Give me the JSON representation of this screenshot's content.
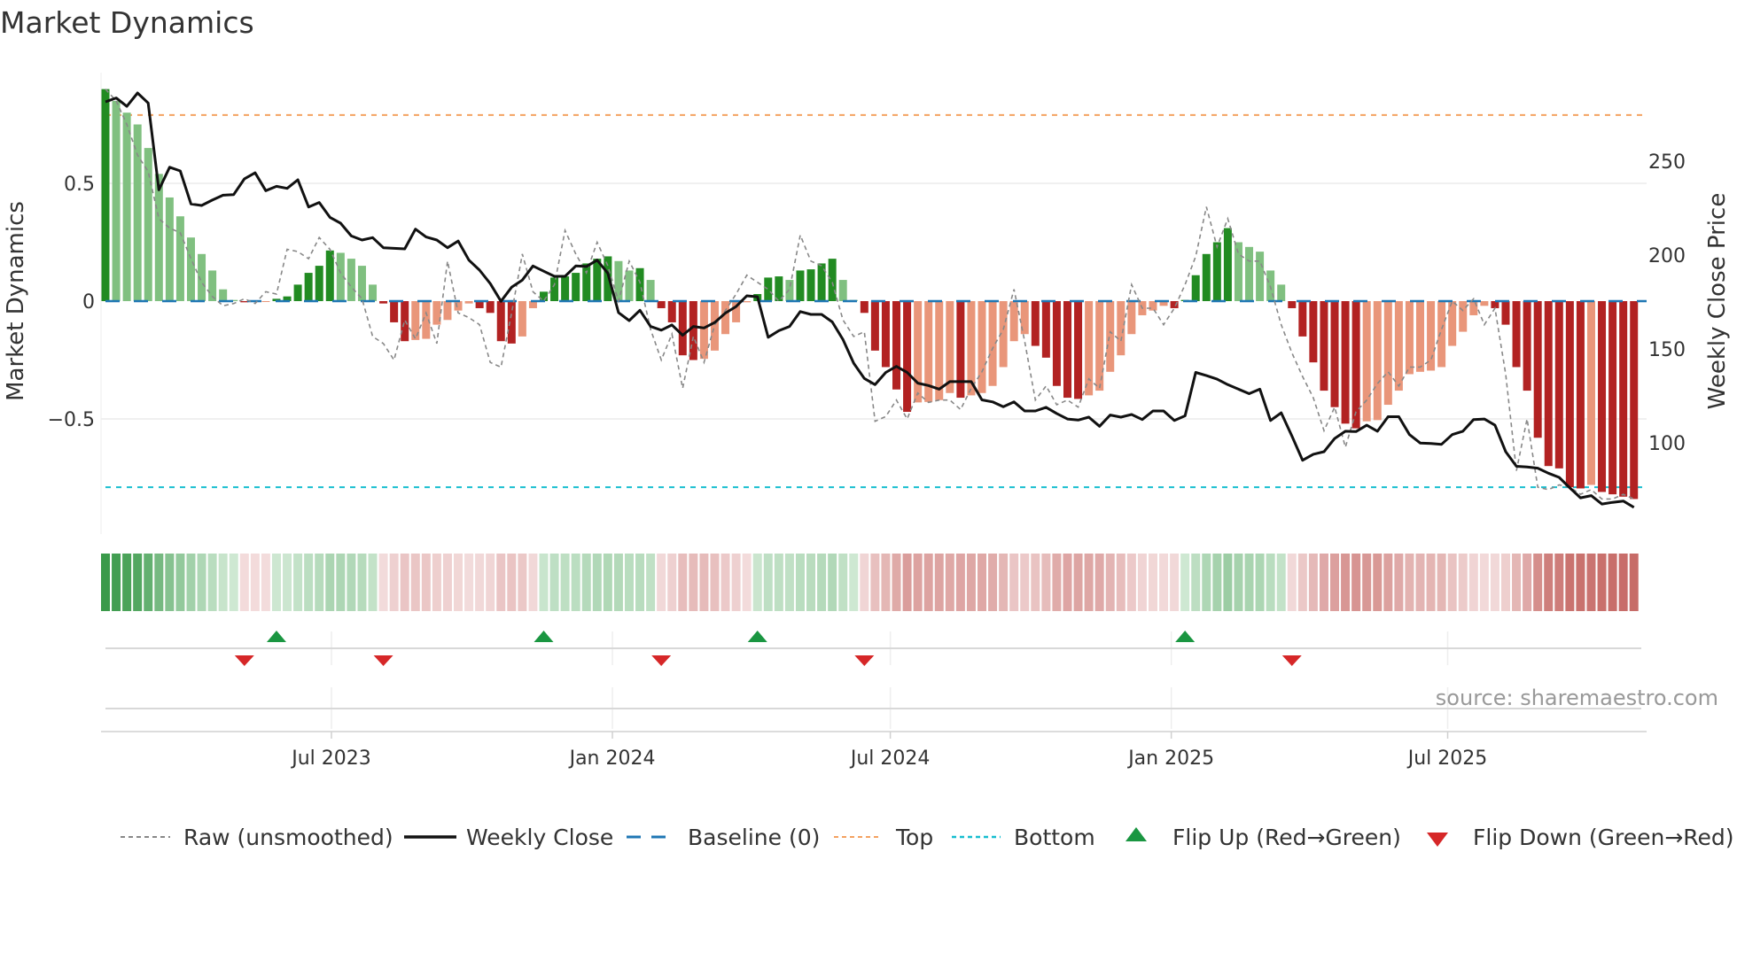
{
  "chart_data": {
    "type": "bar",
    "title": "Market Dynamics",
    "ylabel": "Market Dynamics",
    "y2label": "Weekly Close Price",
    "ylim": [
      -0.98,
      0.98
    ],
    "y2lim": [
      63,
      290
    ],
    "yticks": [
      {
        "value": 0.5,
        "label": "0.5"
      },
      {
        "value": 0,
        "label": "0"
      },
      {
        "value": -0.5,
        "label": "−0.5"
      }
    ],
    "y2ticks": [
      {
        "value": 250,
        "label": "250"
      },
      {
        "value": 200,
        "label": "200"
      },
      {
        "value": 150,
        "label": "150"
      },
      {
        "value": 100,
        "label": "100"
      }
    ],
    "xticks": [
      {
        "date": "2023-07-01",
        "label": "Jul 2023"
      },
      {
        "date": "2024-01-01",
        "label": "Jan 2024"
      },
      {
        "date": "2024-07-01",
        "label": "Jul 2024"
      },
      {
        "date": "2025-01-01",
        "label": "Jan 2025"
      },
      {
        "date": "2025-07-01",
        "label": "Jul 2025"
      }
    ],
    "start_date": "2023-02-03",
    "frequency": "weekly",
    "top_level": 0.79,
    "bottom_level": -0.79,
    "baseline": 0,
    "series": [
      {
        "name": "Market Dynamics (smoothed)",
        "values": [
          0.9,
          0.85,
          0.8,
          0.75,
          0.65,
          0.54,
          0.44,
          0.36,
          0.27,
          0.2,
          0.13,
          0.05,
          0.005,
          -0.005,
          -0.004,
          -0.002,
          0.01,
          0.02,
          0.07,
          0.12,
          0.15,
          0.215,
          0.205,
          0.18,
          0.15,
          0.07,
          -0.01,
          -0.09,
          -0.17,
          -0.165,
          -0.16,
          -0.1,
          -0.08,
          -0.04,
          -0.01,
          -0.03,
          -0.05,
          -0.17,
          -0.18,
          -0.15,
          -0.03,
          0.04,
          0.1,
          0.105,
          0.12,
          0.16,
          0.18,
          0.19,
          0.17,
          0.13,
          0.14,
          0.09,
          -0.03,
          -0.09,
          -0.23,
          -0.25,
          -0.245,
          -0.21,
          -0.14,
          -0.09,
          -0.005,
          0.03,
          0.1,
          0.105,
          0.09,
          0.13,
          0.135,
          0.16,
          0.18,
          0.09,
          0.005,
          -0.05,
          -0.21,
          -0.28,
          -0.375,
          -0.47,
          -0.43,
          -0.428,
          -0.42,
          -0.39,
          -0.41,
          -0.4,
          -0.39,
          -0.36,
          -0.28,
          -0.17,
          -0.14,
          -0.19,
          -0.24,
          -0.36,
          -0.41,
          -0.415,
          -0.4,
          -0.38,
          -0.3,
          -0.23,
          -0.14,
          -0.06,
          -0.04,
          -0.02,
          -0.03,
          0.005,
          0.11,
          0.2,
          0.25,
          0.31,
          0.25,
          0.23,
          0.21,
          0.13,
          0.07,
          -0.03,
          -0.15,
          -0.26,
          -0.38,
          -0.45,
          -0.52,
          -0.54,
          -0.51,
          -0.505,
          -0.44,
          -0.38,
          -0.31,
          -0.3,
          -0.295,
          -0.28,
          -0.19,
          -0.13,
          -0.06,
          -0.02,
          -0.03,
          -0.1,
          -0.28,
          -0.38,
          -0.58,
          -0.7,
          -0.71,
          -0.79,
          -0.795,
          -0.78,
          -0.81,
          -0.82,
          -0.83,
          -0.84
        ]
      },
      {
        "name": "Raw (unsmoothed)",
        "values": [
          0.9,
          0.85,
          0.75,
          0.62,
          0.55,
          0.35,
          0.31,
          0.29,
          0.18,
          0.08,
          0.02,
          -0.02,
          -0.01,
          0.01,
          -0.01,
          0.04,
          0.03,
          0.22,
          0.21,
          0.18,
          0.27,
          0.22,
          0.12,
          0.06,
          0.01,
          -0.15,
          -0.18,
          -0.25,
          -0.08,
          -0.16,
          -0.05,
          -0.18,
          0.17,
          -0.05,
          -0.07,
          -0.1,
          -0.26,
          -0.28,
          -0.05,
          0.2,
          0.04,
          0.0,
          0.07,
          0.3,
          0.2,
          0.12,
          0.25,
          0.15,
          0.0,
          0.17,
          0.08,
          -0.12,
          -0.25,
          -0.14,
          -0.37,
          -0.15,
          -0.26,
          -0.1,
          -0.04,
          0.03,
          0.11,
          0.08,
          0.05,
          0.0,
          0.05,
          0.28,
          0.17,
          0.15,
          0.08,
          -0.08,
          -0.15,
          -0.13,
          -0.51,
          -0.49,
          -0.42,
          -0.5,
          -0.39,
          -0.43,
          -0.42,
          -0.42,
          -0.46,
          -0.37,
          -0.3,
          -0.2,
          -0.12,
          0.05,
          -0.17,
          -0.42,
          -0.36,
          -0.44,
          -0.42,
          -0.45,
          -0.33,
          -0.37,
          -0.13,
          -0.17,
          0.07,
          -0.03,
          -0.03,
          -0.1,
          -0.03,
          0.07,
          0.19,
          0.4,
          0.23,
          0.35,
          0.2,
          0.17,
          0.17,
          0.06,
          -0.1,
          -0.22,
          -0.32,
          -0.41,
          -0.55,
          -0.45,
          -0.62,
          -0.47,
          -0.42,
          -0.35,
          -0.3,
          -0.36,
          -0.28,
          -0.28,
          -0.25,
          -0.12,
          0.0,
          -0.04,
          0.01,
          -0.1,
          -0.03,
          -0.31,
          -0.72,
          -0.5,
          -0.79,
          -0.8,
          -0.78,
          -0.79,
          -0.82,
          -0.8,
          -0.84,
          -0.84,
          -0.82,
          -0.84
        ]
      },
      {
        "name": "Weekly Close",
        "axis": "right",
        "values": [
          281.6,
          283.7,
          279.2,
          286.3,
          281,
          234.7,
          246.8,
          244.8,
          227.2,
          226.4,
          229.3,
          231.9,
          232.2,
          240.6,
          243.8,
          234.3,
          236.6,
          235.5,
          240.1,
          225.6,
          228,
          220.1,
          217,
          210.2,
          208,
          209.3,
          203.9,
          203.6,
          203.3,
          213.8,
          209.6,
          208,
          203.9,
          207.5,
          197.3,
          192,
          184.8,
          175.4,
          182.9,
          186.7,
          194.2,
          191.4,
          188.7,
          188.7,
          194.2,
          193.9,
          197.3,
          190.3,
          169.4,
          165.1,
          170.6,
          162,
          160,
          162.8,
          157.3,
          162,
          161.2,
          164.1,
          169.1,
          172.6,
          178.3,
          177.8,
          156.2,
          159.7,
          162,
          169.9,
          168.4,
          168.4,
          164.4,
          155,
          142.4,
          134.3,
          131,
          137.5,
          140.7,
          137.5,
          131.8,
          130.5,
          128.6,
          132.6,
          132.6,
          132.6,
          122.9,
          121.8,
          119.2,
          121.8,
          117,
          117,
          118.9,
          115.6,
          112.7,
          112.1,
          113.7,
          108.8,
          114.8,
          113.7,
          115.1,
          112.4,
          117,
          117,
          111.9,
          114.4,
          137.5,
          135.8,
          133.9,
          131,
          128.6,
          126.2,
          128.6,
          111.9,
          116,
          103.6,
          90.7,
          93.9,
          95.3,
          102.3,
          106.2,
          106,
          109.4,
          106.2,
          113.9,
          113.9,
          104.4,
          99.9,
          99.6,
          99.2,
          104.4,
          106.2,
          112.4,
          112.7,
          109.4,
          95.3,
          87.5,
          87.1,
          86.5,
          83.8,
          81.6,
          76,
          70.7,
          71.9,
          67.4,
          68.3,
          69,
          65.6
        ]
      }
    ],
    "flip_up_dates": [
      "2023-05-26",
      "2023-11-17",
      "2024-04-05",
      "2025-01-10"
    ],
    "flip_down_dates": [
      "2023-05-05",
      "2023-08-04",
      "2024-02-02",
      "2024-06-14",
      "2025-03-21"
    ],
    "legend": {
      "placement": "bottom",
      "items": [
        {
          "label": "Raw (unsmoothed)",
          "kind": "dotted"
        },
        {
          "label": "Weekly Close",
          "kind": "solid"
        },
        {
          "label": "Baseline (0)",
          "kind": "dashed"
        },
        {
          "label": "Top",
          "kind": "dotted"
        },
        {
          "label": "Bottom",
          "kind": "dotted"
        },
        {
          "label": "Flip Up (Red→Green)",
          "kind": "triangle-up"
        },
        {
          "label": "Flip Down (Green→Red)",
          "kind": "triangle-down"
        }
      ]
    },
    "source": "source: sharemaestro.com",
    "colors": {
      "green_strong": "#228b22",
      "green_light": "#80c080",
      "red_strong": "#b22222",
      "red_light": "#e9967a",
      "raw": "#888888",
      "close": "#111111",
      "baseline": "#1f77b4",
      "top": "#f4a261",
      "bottom": "#17becf",
      "flip_up": "#1a9641",
      "flip_down": "#d62728"
    }
  }
}
